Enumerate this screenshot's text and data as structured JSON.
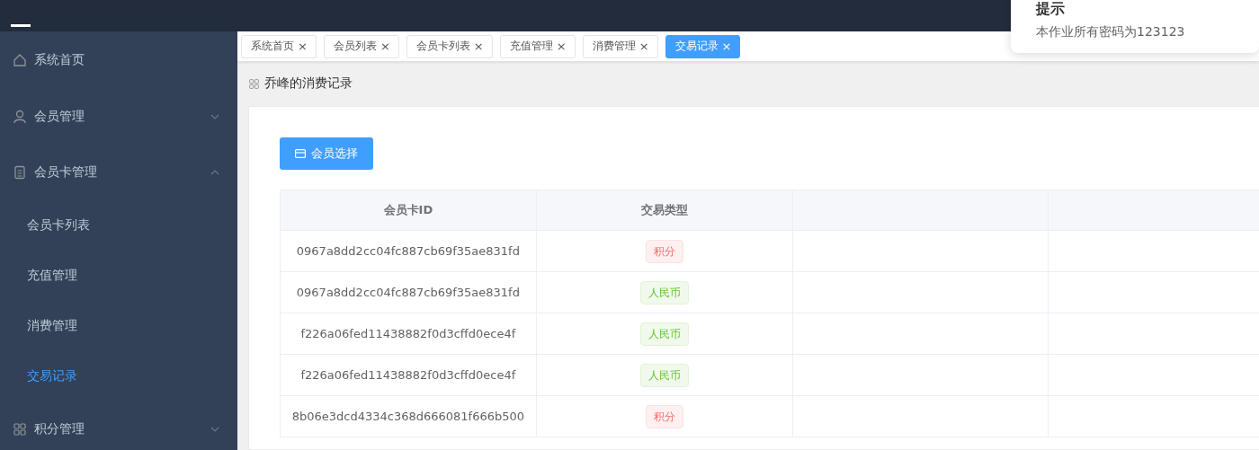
{
  "notification": {
    "title": "提示",
    "message": "本作业所有密码为123123"
  },
  "sidebar": {
    "items": [
      {
        "label": "系统首页",
        "kind": "home",
        "selected": false
      },
      {
        "label": "会员管理",
        "kind": "user",
        "expanded": false,
        "selected": false
      },
      {
        "label": "会员卡管理",
        "kind": "doc",
        "expanded": true,
        "selected": false,
        "children": [
          {
            "label": "会员卡列表",
            "selected": false
          },
          {
            "label": "充值管理",
            "selected": false
          },
          {
            "label": "消费管理",
            "selected": false
          },
          {
            "label": "交易记录",
            "selected": true
          }
        ]
      },
      {
        "label": "积分管理",
        "kind": "grid",
        "expanded": false,
        "selected": false
      }
    ]
  },
  "tabs": [
    {
      "label": "系统首页",
      "close": "×",
      "selected": false
    },
    {
      "label": "会员列表",
      "close": "×",
      "selected": false
    },
    {
      "label": "会员卡列表",
      "close": "×",
      "selected": false
    },
    {
      "label": "充值管理",
      "close": "×",
      "selected": false
    },
    {
      "label": "消费管理",
      "close": "×",
      "selected": false
    },
    {
      "label": "交易记录",
      "close": "×",
      "selected": true
    }
  ],
  "breadcrumb": "乔峰的消费记录",
  "select_button": "会员选择",
  "table": {
    "columns": [
      "会员卡ID",
      "交易类型"
    ],
    "rows": [
      {
        "card_id": "0967a8dd2cc04fc887cb69f35ae831fd",
        "type": {
          "label": "积分",
          "kind": "danger"
        }
      },
      {
        "card_id": "0967a8dd2cc04fc887cb69f35ae831fd",
        "type": {
          "label": "人民币",
          "kind": "success"
        }
      },
      {
        "card_id": "f226a06fed11438882f0d3cffd0ece4f",
        "type": {
          "label": "人民币",
          "kind": "success"
        }
      },
      {
        "card_id": "f226a06fed11438882f0d3cffd0ece4f",
        "type": {
          "label": "人民币",
          "kind": "success"
        }
      },
      {
        "card_id": "8b06e3dcd4334c368d666081f666b500",
        "type": {
          "label": "积分",
          "kind": "danger"
        }
      }
    ]
  }
}
